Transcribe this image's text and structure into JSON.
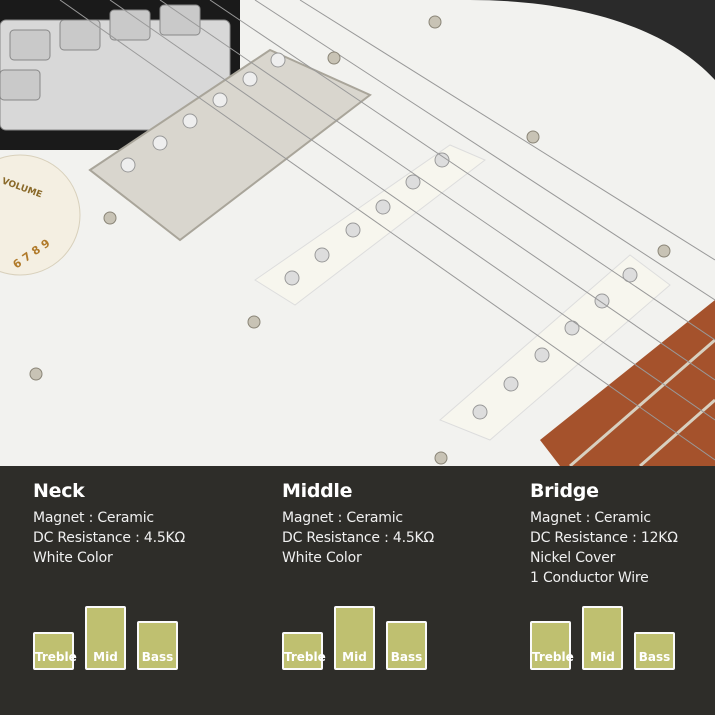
{
  "colors": {
    "panel_bg": "#2e2d29",
    "bar_fill": "#bfc070",
    "bar_border": "#fafafa",
    "pickguard": "#f2f2ef",
    "body": "#2a2a2a",
    "fretboard": "#a5522c"
  },
  "photo": {
    "knob_text": "VOLUME",
    "knob_numbers": "6 7 8 9"
  },
  "pickups": [
    {
      "name": "Neck",
      "specs": [
        "Magnet : Ceramic",
        "DC Resistance : 4.5KΩ",
        "White Color"
      ],
      "tone": [
        {
          "label": "Treble",
          "level": 0.6
        },
        {
          "label": "Mid",
          "level": 1.0
        },
        {
          "label": "Bass",
          "level": 0.77
        }
      ]
    },
    {
      "name": "Middle",
      "specs": [
        "Magnet : Ceramic",
        "DC Resistance : 4.5KΩ",
        "White Color"
      ],
      "tone": [
        {
          "label": "Treble",
          "level": 0.6
        },
        {
          "label": "Mid",
          "level": 1.0
        },
        {
          "label": "Bass",
          "level": 0.77
        }
      ]
    },
    {
      "name": "Bridge",
      "specs": [
        "Magnet : Ceramic",
        "DC Resistance : 12KΩ",
        "Nickel Cover",
        "1 Conductor Wire"
      ],
      "tone": [
        {
          "label": "Treble",
          "level": 0.77
        },
        {
          "label": "Mid",
          "level": 1.0
        },
        {
          "label": "Bass",
          "level": 0.6
        }
      ]
    }
  ]
}
